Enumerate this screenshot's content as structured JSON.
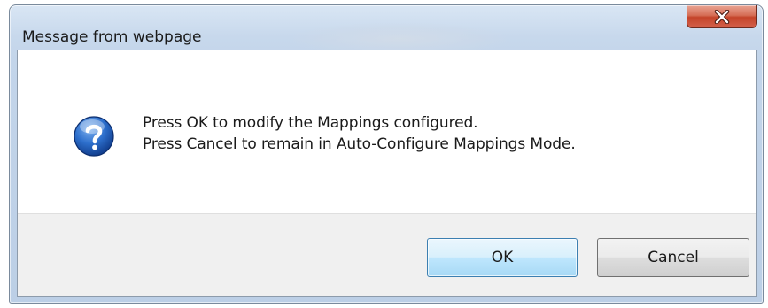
{
  "window": {
    "title": "Message from webpage"
  },
  "icons": {
    "close": "close-icon",
    "question": "question-icon"
  },
  "message": {
    "line1": "Press OK to modify the Mappings configured.",
    "line2": "Press Cancel to remain in Auto-Configure Mappings Mode."
  },
  "buttons": {
    "ok_label": "OK",
    "cancel_label": "Cancel"
  },
  "colors": {
    "close_button": "#c4442a",
    "question_icon": "#1f5fb8",
    "default_button_border": "#3c7fb1"
  }
}
